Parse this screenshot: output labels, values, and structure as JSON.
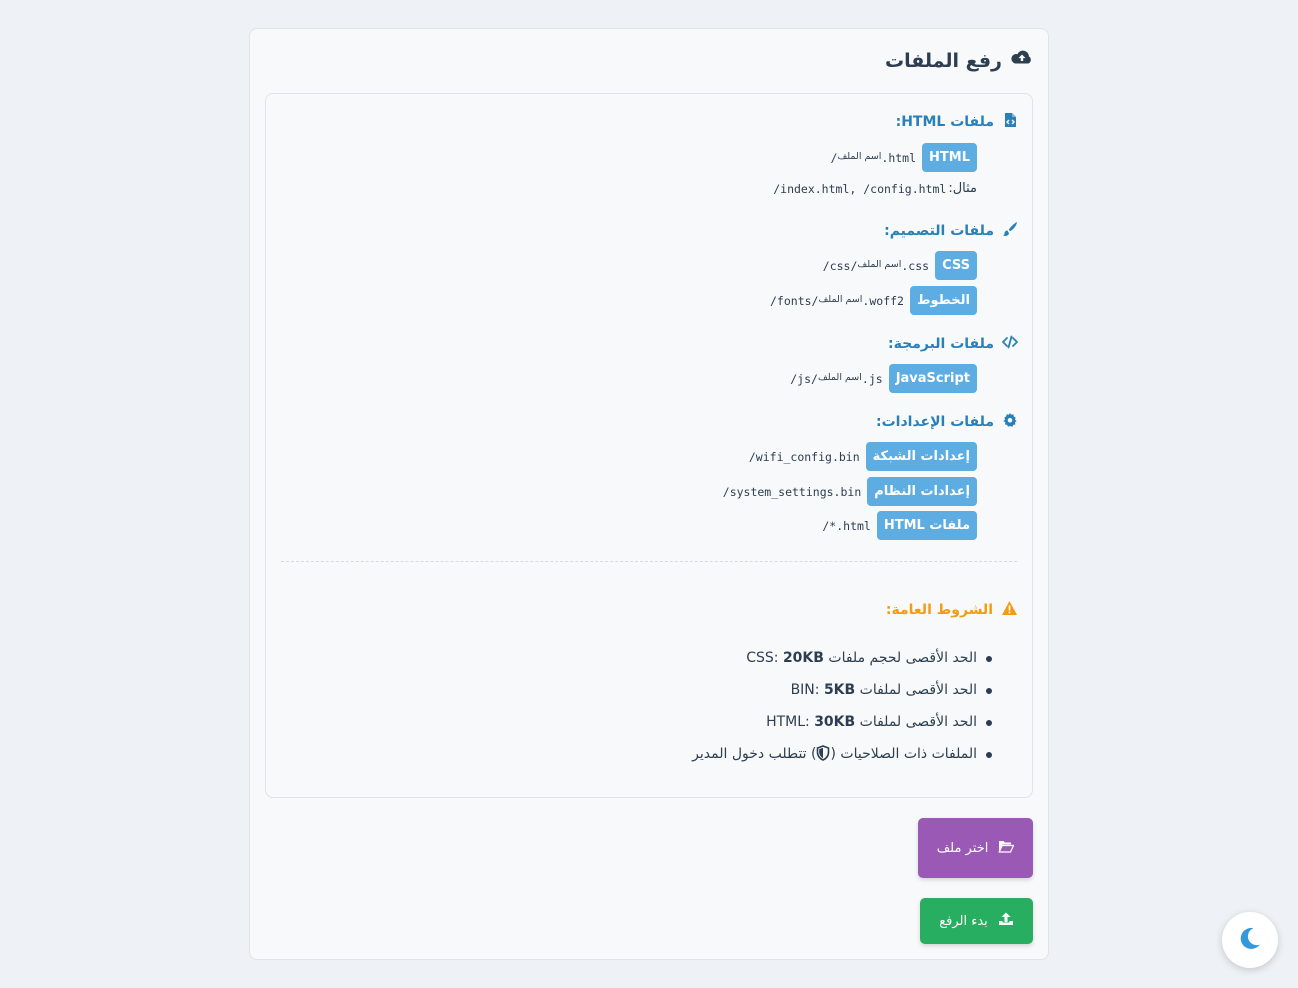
{
  "card": {
    "title": "رفع الملفات",
    "icon": "cloud-upload-icon"
  },
  "sections": {
    "html": {
      "title": "ملفات HTML:",
      "icon": "file-code-icon",
      "badge": "HTML",
      "path_prefix": "/",
      "path_name": "اسم الملف",
      "path_suffix": ".html",
      "example_label": "مثال:",
      "example_value": "/index.html, /config.html"
    },
    "design": {
      "title": "ملفات التصميم:",
      "icon": "paint-brush-icon",
      "items": [
        {
          "badge": "CSS",
          "path_prefix": "/css/",
          "path_name": "اسم الملف",
          "path_suffix": ".css"
        },
        {
          "badge": "الخطوط",
          "path_prefix": "/fonts/",
          "path_name": "اسم الملف",
          "path_suffix": ".woff2"
        }
      ]
    },
    "code": {
      "title": "ملفات البرمجة:",
      "icon": "code-icon",
      "badge": "JavaScript",
      "path_prefix": "/js/",
      "path_name": "اسم الملف",
      "path_suffix": ".js"
    },
    "settings": {
      "title": "ملفات الإعدادات:",
      "icon": "gear-icon",
      "items": [
        {
          "badge": "إعدادات الشبكة",
          "path": "/wifi_config.bin"
        },
        {
          "badge": "إعدادات النظام",
          "path": "/system_settings.bin"
        },
        {
          "badge": "ملفات HTML",
          "path": "/*.html"
        }
      ]
    }
  },
  "terms": {
    "title": "الشروط العامة:",
    "icon": "warning-icon",
    "items": [
      {
        "pre": "الحد الأقصى لحجم ملفات CSS: ",
        "bold": "20KB"
      },
      {
        "pre": "الحد الأقصى لملفات BIN: ",
        "bold": "5KB"
      },
      {
        "pre": "الحد الأقصى لملفات HTML: ",
        "bold": "30KB"
      }
    ],
    "admin_note_pre": "الملفات ذات الصلاحيات (",
    "admin_note_post": ") تتطلب دخول المدير"
  },
  "buttons": {
    "choose_file": "اختر ملف",
    "start_upload": "بدء الرفع"
  },
  "colors": {
    "accent": "#2980b9",
    "badge": "#5dade2",
    "warning": "#f39c12",
    "choose_button": "#9b59b6",
    "upload_button": "#27ae60"
  }
}
